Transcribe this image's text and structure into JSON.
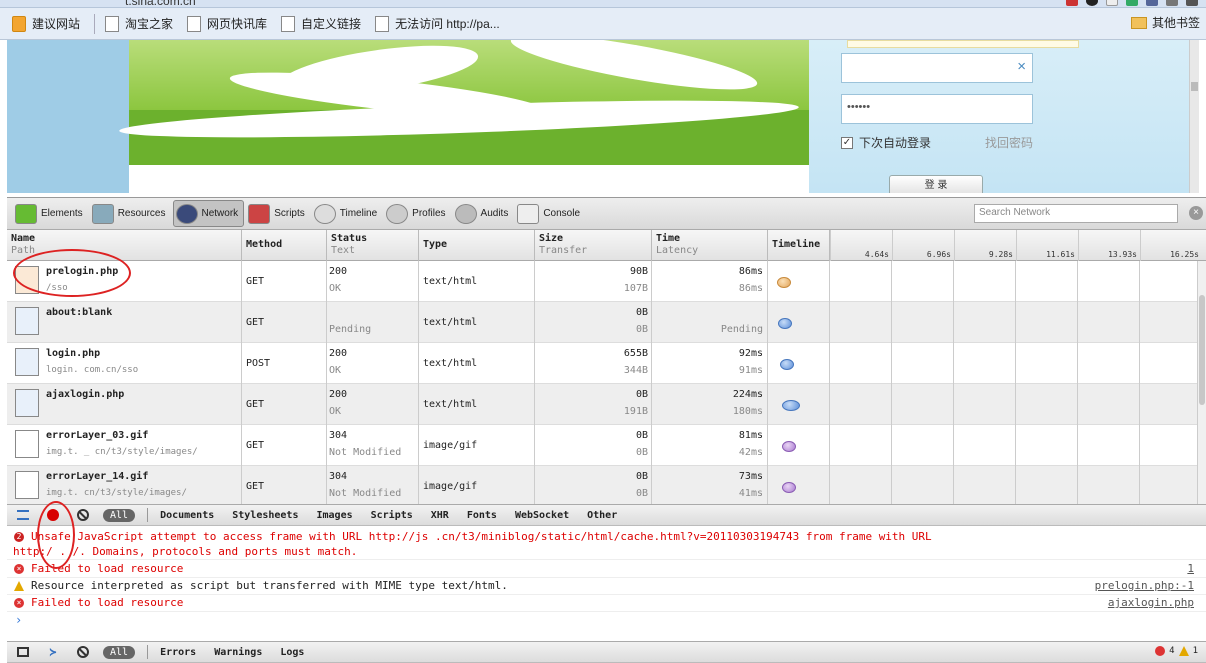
{
  "browser": {
    "url": "t.sina.com.cn",
    "bookmarks": [
      "建议网站",
      "淘宝之家",
      "网页快讯库",
      "自定义链接",
      "无法访问 http://pa..."
    ],
    "other_bookmarks": "其他书签"
  },
  "page": {
    "password_mask": "••••••",
    "remember_label": "下次自动登录",
    "forgot_label": "找回密码",
    "login_button": "登 录"
  },
  "devtools": {
    "tabs": [
      "Elements",
      "Resources",
      "Network",
      "Scripts",
      "Timeline",
      "Profiles",
      "Audits",
      "Console"
    ],
    "active_tab": "Network",
    "search_placeholder": "Search Network",
    "columns": {
      "name": "Name",
      "path": "Path",
      "method": "Method",
      "status": "Status",
      "text": "Text",
      "type": "Type",
      "size": "Size",
      "transfer": "Transfer",
      "time": "Time",
      "latency": "Latency",
      "timeline": "Timeline"
    },
    "timeline_marks": [
      "4.64s",
      "6.96s",
      "9.28s",
      "11.61s",
      "13.93s",
      "16.25s"
    ],
    "requests": [
      {
        "name": "prelogin.php",
        "path": "               /sso",
        "method": "GET",
        "status": "200",
        "status_text": "OK",
        "type": "text/html",
        "size": "90B",
        "transfer": "107B",
        "time": "86ms",
        "latency": "86ms",
        "color": "orange"
      },
      {
        "name": "about:blank",
        "path": "",
        "method": "GET",
        "status": "",
        "status_text": "Pending",
        "type": "text/html",
        "size": "0B",
        "transfer": "0B",
        "time": "",
        "latency": "Pending",
        "color": "blue"
      },
      {
        "name": "login.php",
        "path": "login.     com.cn/sso",
        "method": "POST",
        "status": "200",
        "status_text": "OK",
        "type": "text/html",
        "size": "655B",
        "transfer": "344B",
        "time": "92ms",
        "latency": "91ms",
        "color": "blue"
      },
      {
        "name": "ajaxlogin.php",
        "path": "",
        "method": "GET",
        "status": "200",
        "status_text": "OK",
        "type": "text/html",
        "size": "0B",
        "transfer": "191B",
        "time": "224ms",
        "latency": "180ms",
        "color": "blue"
      },
      {
        "name": "errorLayer_03.gif",
        "path": "img.t.    _ cn/t3/style/images/",
        "method": "GET",
        "status": "304",
        "status_text": "Not Modified",
        "type": "image/gif",
        "size": "0B",
        "transfer": "0B",
        "time": "81ms",
        "latency": "42ms",
        "color": "purple"
      },
      {
        "name": "errorLayer_14.gif",
        "path": "img.t.      cn/t3/style/images/",
        "method": "GET",
        "status": "304",
        "status_text": "Not Modified",
        "type": "image/gif",
        "size": "0B",
        "transfer": "0B",
        "time": "73ms",
        "latency": "41ms",
        "color": "purple"
      }
    ],
    "network_filter": {
      "all": "All",
      "filters": [
        "Documents",
        "Stylesheets",
        "Images",
        "Scripts",
        "XHR",
        "Fonts",
        "WebSocket",
        "Other"
      ]
    },
    "console": [
      {
        "level": "error",
        "count": "2",
        "text": "Unsafe JavaScript attempt to access frame with URL http://js          .cn/t3/miniblog/static/html/cache.html?v=20110303194743 from frame with URL",
        "text2": "http:/  .          /. Domains, protocols and ports must match.",
        "source": ""
      },
      {
        "level": "error",
        "text": "Failed to load resource",
        "source": "1"
      },
      {
        "level": "warning",
        "text": "Resource interpreted as script but transferred with MIME type text/html.",
        "source": "prelogin.php:-1"
      },
      {
        "level": "error",
        "text": "Failed to load resource",
        "source": "ajaxlogin.php"
      }
    ],
    "console_filter": {
      "all": "All",
      "filters": [
        "Errors",
        "Warnings",
        "Logs"
      ]
    },
    "counts": {
      "errors": "4",
      "warnings": "1"
    }
  }
}
